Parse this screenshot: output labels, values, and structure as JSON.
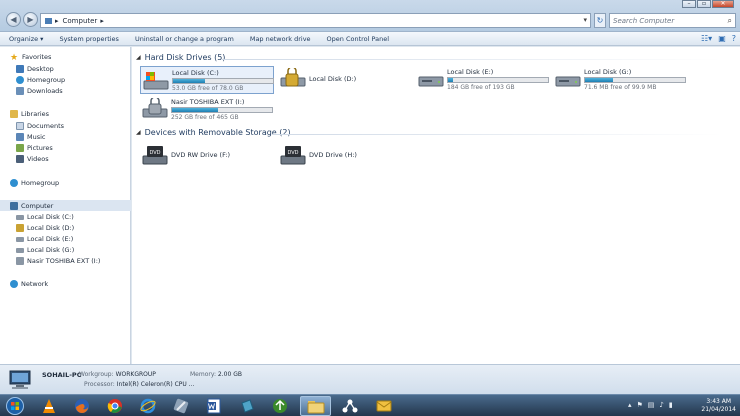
{
  "address": {
    "segment": "Computer",
    "root_arrow": "▸",
    "seg_arrow": "▸"
  },
  "search": {
    "placeholder": "Search Computer"
  },
  "window_controls": {
    "min": "–",
    "max": "▫",
    "close": "✕"
  },
  "commands": {
    "organize": "Organize ▾",
    "system_properties": "System properties",
    "uninstall": "Uninstall or change a program",
    "map_drive": "Map network drive",
    "control_panel": "Open Control Panel"
  },
  "nav": {
    "favorites": "Favorites",
    "desktop": "Desktop",
    "homegroup_fav": "Homegroup",
    "downloads": "Downloads",
    "libraries": "Libraries",
    "documents": "Documents",
    "music": "Music",
    "pictures": "Pictures",
    "videos": "Videos",
    "homegroup": "Homegroup",
    "computer": "Computer",
    "disk_c": "Local Disk (C:)",
    "disk_d": "Local Disk (D:)",
    "disk_e": "Local Disk (E:)",
    "disk_g": "Local Disk (G:)",
    "toshiba": "Nasir TOSHIBA EXT (I:)",
    "network": "Network"
  },
  "groups": {
    "hdd": "Hard Disk Drives (5)",
    "removable": "Devices with Removable Storage (2)"
  },
  "drives": [
    {
      "name": "Local Disk (C:)",
      "free": "53.0 GB free of 78.0 GB",
      "used_fraction": 0.32
    },
    {
      "name": "Local Disk (D:)",
      "free": "",
      "used_fraction": null
    },
    {
      "name": "Local Disk (E:)",
      "free": "184 GB free of 193 GB",
      "used_fraction": 0.05
    },
    {
      "name": "Local Disk (G:)",
      "free": "71.6 MB free of 99.9 MB",
      "used_fraction": 0.28
    },
    {
      "name": "Nasir TOSHIBA EXT (I:)",
      "free": "252 GB free of 465 GB",
      "used_fraction": 0.46
    }
  ],
  "removable": [
    {
      "name": "DVD RW Drive (F:)",
      "label": "DVD"
    },
    {
      "name": "DVD Drive (H:)",
      "label": "DVD"
    }
  ],
  "details": {
    "pc_name": "SOHAIL-PC",
    "workgroup_label": "Workgroup:",
    "workgroup": "WORKGROUP",
    "memory_label": "Memory:",
    "memory": "2.00 GB",
    "processor_label": "Processor:",
    "processor": "Intel(R) Celeron(R) CPU ..."
  },
  "tray": {
    "time": "3:43 AM",
    "date": "21/04/2014"
  },
  "colors": {
    "bar_fill": "#1e7fb3",
    "selection": "#dbe5f1",
    "taskbar": "#23364c"
  }
}
